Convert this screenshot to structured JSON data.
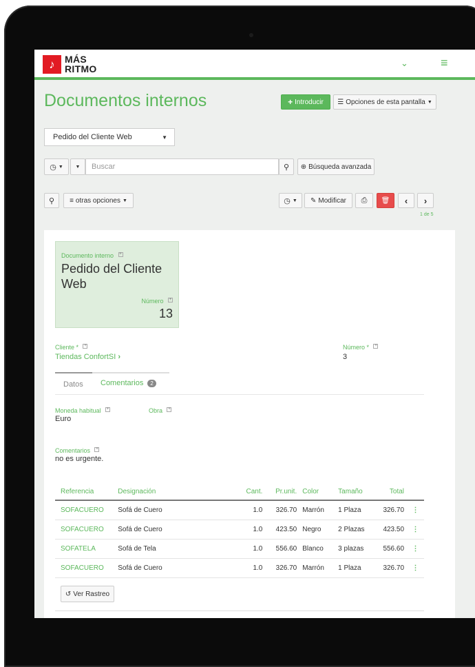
{
  "brand": {
    "logo_glyph": "♪",
    "line1": "MÁS",
    "line2": "RITMO",
    "accent": "#5cb85c",
    "logo_red": "#e21b23"
  },
  "nav": {
    "chevron": "⌄",
    "menu": "≡"
  },
  "page_title": "Documentos internos",
  "toolbar": {
    "introducir": "Introducir",
    "opciones": "Opciones de esta pantalla"
  },
  "doc_type_select": "Pedido del Cliente Web",
  "search": {
    "placeholder": "Buscar",
    "advanced": "Búsqueda avanzada"
  },
  "actions": {
    "otras_opciones": "otras opciones",
    "modificar": "Modificar",
    "pager": "1 de 5"
  },
  "tile": {
    "label": "Documento interno",
    "title_line1": "Pedido del Cliente",
    "title_line2": "Web",
    "numero_label": "Número",
    "numero_value": "13"
  },
  "fields": {
    "cliente_label": "Cliente *",
    "cliente_value": "Tiendas ConfortSI",
    "numero_label": "Número *",
    "numero_value": "3",
    "moneda_label": "Moneda habitual",
    "moneda_value": "Euro",
    "obra_label": "Obra",
    "comentarios_label": "Comentarios",
    "comentarios_value": "no es urgente."
  },
  "tabs": {
    "datos": "Datos",
    "comentarios": "Comentarios",
    "comentarios_count": "2"
  },
  "table": {
    "headers": [
      "Referencia",
      "Designación",
      "Cant.",
      "Pr.unit.",
      "Color",
      "Tamaño",
      "Total"
    ],
    "rows": [
      [
        "SOFACUERO",
        "Sofá de Cuero",
        "1.0",
        "326.70",
        "Marrón",
        "1 Plaza",
        "326.70"
      ],
      [
        "SOFACUERO",
        "Sofá de Cuero",
        "1.0",
        "423.50",
        "Negro",
        "2 Plazas",
        "423.50"
      ],
      [
        "SOFATELA",
        "Sofá de Tela",
        "1.0",
        "556.60",
        "Blanco",
        "3 plazas",
        "556.60"
      ],
      [
        "SOFACUERO",
        "Sofá de Cuero",
        "1.0",
        "326.70",
        "Marrón",
        "1 Plaza",
        "326.70"
      ]
    ]
  },
  "ver_rastreo": "Ver Rastreo"
}
